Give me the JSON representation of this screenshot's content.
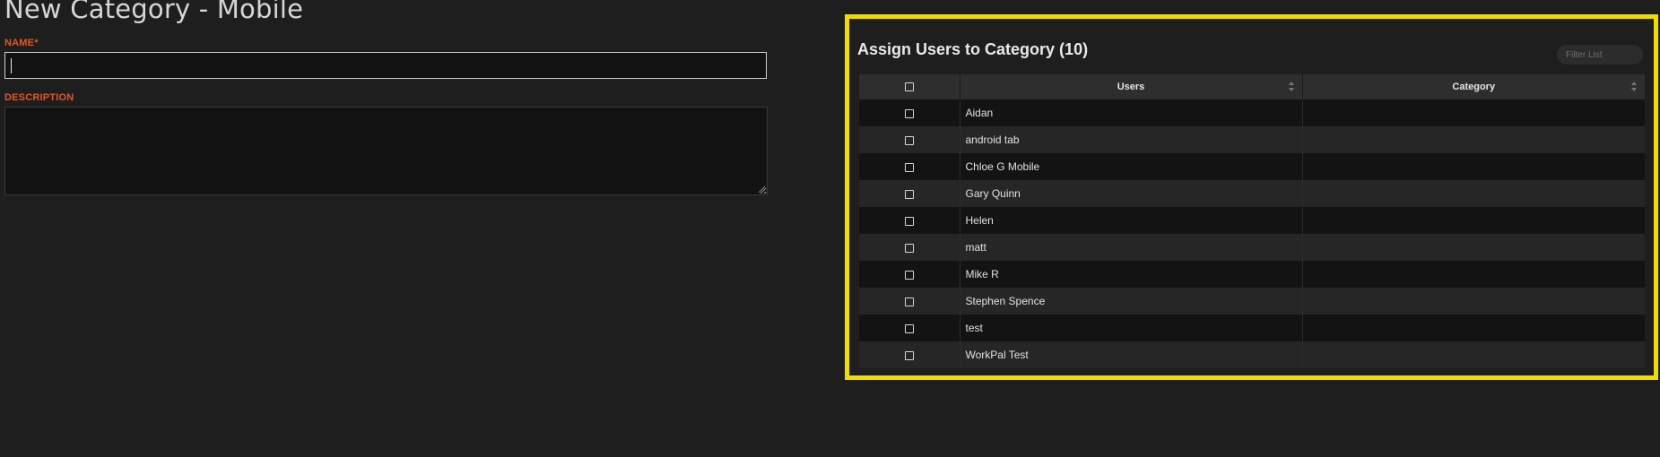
{
  "page": {
    "title": "New Category - Mobile"
  },
  "form": {
    "name_label": "NAME*",
    "name_value": "",
    "description_label": "DESCRIPTION",
    "description_value": ""
  },
  "assign_panel": {
    "title": "Assign Users to Category (10)",
    "filter_placeholder": "Filter List",
    "columns": [
      "Users",
      "Category"
    ],
    "rows": [
      {
        "user": "Aidan",
        "category": "",
        "checked": false
      },
      {
        "user": "android tab",
        "category": "",
        "checked": false
      },
      {
        "user": "Chloe G Mobile",
        "category": "",
        "checked": false
      },
      {
        "user": "Gary Quinn",
        "category": "",
        "checked": false
      },
      {
        "user": "Helen",
        "category": "",
        "checked": false
      },
      {
        "user": "matt",
        "category": "",
        "checked": false
      },
      {
        "user": "Mike R",
        "category": "",
        "checked": false
      },
      {
        "user": "Stephen Spence",
        "category": "",
        "checked": false
      },
      {
        "user": "test",
        "category": "",
        "checked": false
      },
      {
        "user": "WorkPal Test",
        "category": "",
        "checked": false
      }
    ]
  },
  "colors": {
    "background": "#1e1e1e",
    "label_accent": "#e0562a",
    "panel_highlight": "#f1dc00"
  },
  "icons": [
    "checkbox-icon",
    "sort-icon",
    "resize-grip-icon"
  ]
}
